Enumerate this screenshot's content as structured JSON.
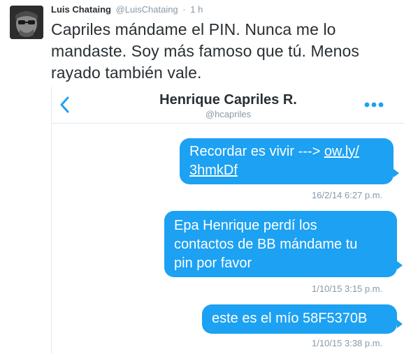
{
  "tweet": {
    "author_name": "Luis Chataing",
    "author_handle": "@LuisChataing",
    "separator": "·",
    "time": "1 h",
    "text": "Capriles mándame el PIN. Nunca me lo mandaste. Soy más famoso que tú. Menos rayado también vale."
  },
  "dm": {
    "contact_name": "Henrique Capriles R.",
    "contact_handle": "@hcapriles",
    "messages": [
      {
        "text_line1_prefix": "Recordar es vivir ---> ",
        "link_part1": "ow.ly/",
        "link_part2": "3hmkDf",
        "timestamp": "16/2/14 6:27 p.m."
      },
      {
        "line1": "Epa Henrique perdí los",
        "line2": "contactos de BB mándame tu",
        "line3": "pin por favor",
        "timestamp": "1/10/15 3:15 p.m."
      },
      {
        "line1": "este es el mío 58F5370B",
        "timestamp": "1/10/15 3:38 p.m."
      }
    ]
  },
  "colors": {
    "bubble": "#1da1f2",
    "accent": "#1da1f2",
    "muted": "#8899a6"
  },
  "icons": {
    "avatar": "avatar-photo",
    "back": "chevron-left-icon",
    "more": "more-dots-icon"
  }
}
